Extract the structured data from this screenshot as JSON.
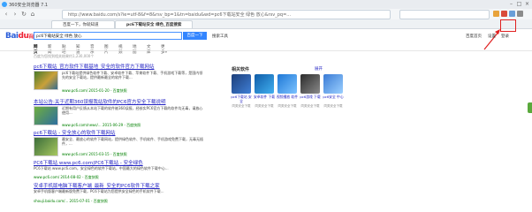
{
  "window": {
    "title": "360安全浏览器 7.1"
  },
  "nav": {
    "back": "‹",
    "forward": "›",
    "refresh": "↻",
    "home": "⌂"
  },
  "address_bar": {
    "url": "http://www.baidu.com/s?ie=utf-8&f=8&rsv_bp=1&tn=baidu&wd=pc6下载站安全 绿色 放心&rsv_pq=..."
  },
  "tabs": [
    {
      "label": "百度一下，你就知道"
    },
    {
      "label": "pc6下载站安全 绿色_百度搜索"
    }
  ],
  "baidu": {
    "logo_main": "Bai",
    "logo_accent": "du",
    "logo_tail": "百度",
    "query": "pc6下载站安全 绿色 放心",
    "search_button": "百度一下",
    "advanced": "搜索工具",
    "user_links": [
      "百度首页",
      "设置",
      "登录"
    ],
    "tabs": [
      "网页",
      "新闻",
      "贴吧",
      "知道",
      "音乐",
      "图片",
      "视频",
      "地图",
      "文库",
      "更多»"
    ],
    "result_info": "百度为您找到相关结果约1,230,000个"
  },
  "results": [
    {
      "title": "pc6下载站_官方软件下载基地_安全的软件官方下载网站",
      "desc": "pc6下载站提供绿色软件下载、安卓软件下载、苹果软件下载、手机游戏下载等，是国内领先的安全下载站，提供最新最全的软件下载...",
      "url": "www.pc6.com/ 2015-01-20 - 百度快照"
    },
    {
      "title": "本站公告:关于近期360误报我站软件的PC6官方安全下载说明",
      "desc": "近期有用户反馈从本站下载的软件被360误报，经核实PC6官方下载的软件均无毒，请放心使用...",
      "url": "www.pc6.com/news/... 2015-06-29 - 百度快照"
    },
    {
      "title": "pc6下载站 - 安全放心的软件下载网站",
      "desc": "最安全、最放心的软件下载网站，提供绿色软件、手机软件、手机游戏免费下载，无毒无插件，...",
      "url": "www.pc6.com/ 2015-03-15 - 百度快照"
    },
    {
      "title": "PC6下载站 www.pc6.com|PC6下载站 - 安全绿色",
      "desc": "PC6下载站 www.pc6.com，安全绿色的软件下载站，中国最大的绿色软件下载中心...",
      "url": "www.pc6.com/ 2014-08-02 - 百度快照"
    },
    {
      "title": "安卓手机版电脑下载客户端_最新_安全的PC6软件下载之家",
      "desc": "安卓手机版客户端最新版免费下载，PC6下载站为您提供安全绿色的手机软件下载...",
      "url": "shouji.baidu.com/... 2015-07-01 - 百度快照"
    }
  ],
  "sidebar": {
    "title": "相关软件",
    "more": "展开",
    "apps": [
      {
        "name": "pc6下载站 安全",
        "sub": "同类安全下载"
      },
      {
        "name": "安卓软件 下载",
        "sub": "同类安全下载"
      },
      {
        "name": "视频播放 软件",
        "sub": "同类安全下载"
      },
      {
        "name": "pc6游戏 下载",
        "sub": "同类安全下载"
      },
      {
        "name": "pc6安全 中心",
        "sub": "同类安全下载"
      }
    ]
  },
  "colors": {
    "accent": "#3385ff",
    "link": "#2626c4",
    "highlight": "#dd0000",
    "url_green": "#008000",
    "annotation_red": "#e02020"
  }
}
